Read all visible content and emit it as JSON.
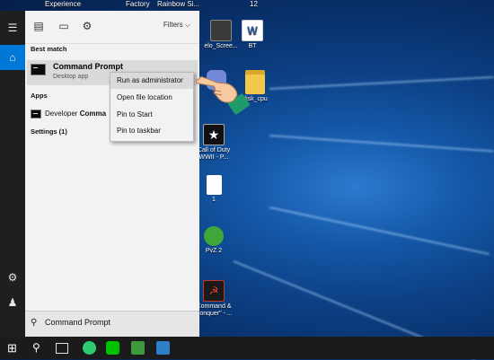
{
  "desktop": {
    "top_labels": [
      "Experience",
      "Factory",
      "Rainbow Si...",
      "12"
    ],
    "icons": [
      {
        "label": "elo_Scree...",
        "icon": "screenshot-icon"
      },
      {
        "label": "BT",
        "icon": "word-document-icon"
      },
      {
        "label": "",
        "icon": "discord-icon"
      },
      {
        "label": "disk_cpu",
        "icon": "folder-icon"
      },
      {
        "label": "Call of Duty WWII - P...",
        "icon": "call-of-duty-icon"
      },
      {
        "label": "1",
        "icon": "blank-file-icon"
      },
      {
        "label": "PvZ 2",
        "icon": "pvz2-icon"
      },
      {
        "label": "Command & Conquer\" - ...",
        "icon": "command-conquer-icon"
      }
    ]
  },
  "start_menu": {
    "filters_label": "Filters",
    "best_match_heading": "Best match",
    "best_match": {
      "name": "Command Prompt",
      "subtitle": "Desktop app"
    },
    "apps_heading": "Apps",
    "app_item_prefix": "Developer ",
    "app_item_bold": "Comma",
    "settings_heading": "Settings (1)",
    "search_text": "Command Prompt"
  },
  "context_menu": {
    "items": [
      "Run as administrator",
      "Open file location",
      "Pin to Start",
      "Pin to taskbar"
    ]
  },
  "colors": {
    "accent": "#0078d7",
    "menu_bg": "#f2f2f2",
    "rail_bg": "#1f1f1f",
    "taskbar_bg": "#1b1b1b"
  }
}
